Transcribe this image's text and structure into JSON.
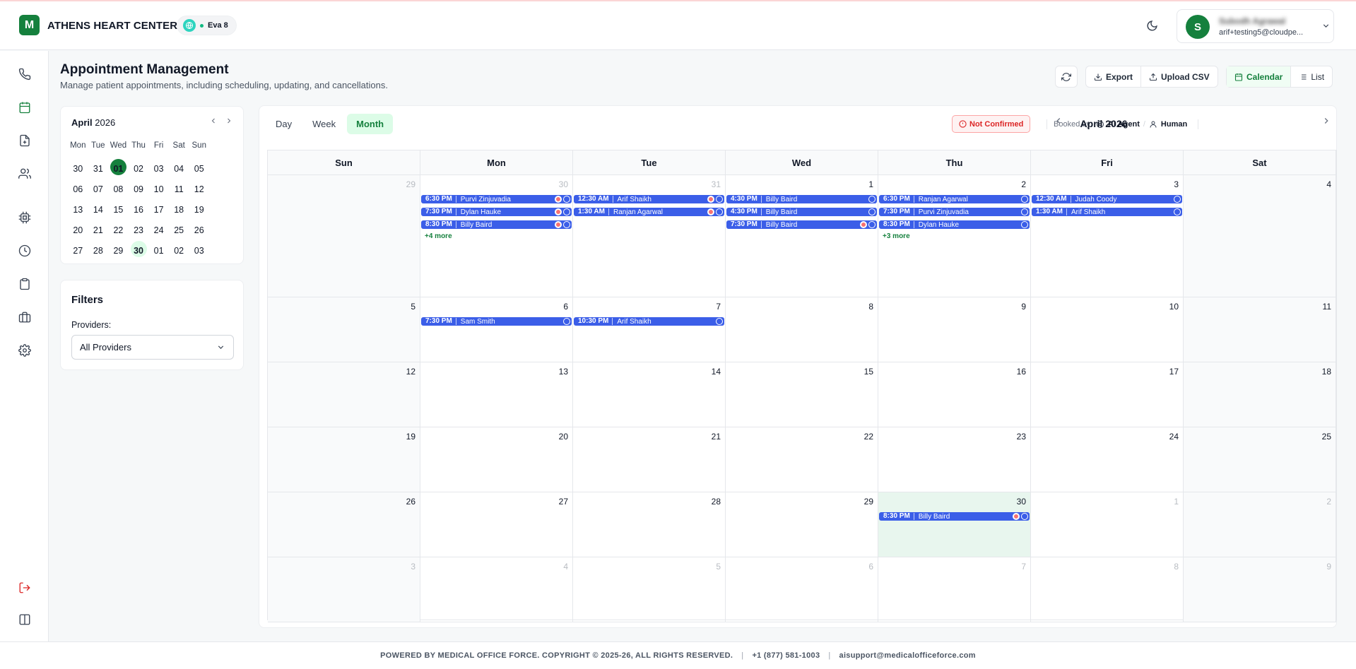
{
  "header": {
    "logo_letter": "M",
    "org_name": "ATHENS HEART CENTER",
    "agent_label": "Eva 8",
    "user_initial": "S",
    "user_name": "Subodh Agrawal",
    "user_email": "arif+testing5@cloudpe..."
  },
  "page": {
    "title": "Appointment Management",
    "subtitle": "Manage patient appointments, including scheduling, updating, and cancellations."
  },
  "toolbar": {
    "export_label": "Export",
    "upload_label": "Upload CSV",
    "calendar_label": "Calendar",
    "list_label": "List"
  },
  "mini_calendar": {
    "month": "April",
    "year": "2026",
    "weekdays": [
      "Mon",
      "Tue",
      "Wed",
      "Thu",
      "Fri",
      "Sat",
      "Sun"
    ],
    "weeks": [
      [
        "30",
        "31",
        "01",
        "02",
        "03",
        "04",
        "05"
      ],
      [
        "06",
        "07",
        "08",
        "09",
        "10",
        "11",
        "12"
      ],
      [
        "13",
        "14",
        "15",
        "16",
        "17",
        "18",
        "19"
      ],
      [
        "20",
        "21",
        "22",
        "23",
        "24",
        "25",
        "26"
      ],
      [
        "27",
        "28",
        "29",
        "30",
        "01",
        "02",
        "03"
      ]
    ],
    "selected": "01",
    "today": "30"
  },
  "filters": {
    "title": "Filters",
    "providers_label": "Providers:",
    "providers_value": "All Providers"
  },
  "calendar": {
    "views": [
      "Day",
      "Week",
      "Month"
    ],
    "active_view": "Month",
    "not_confirmed_label": "Not Confirmed",
    "booked_by_label": "Booked by:",
    "ai_agent_label": "AI Agent",
    "human_label": "Human",
    "month_title": "April 2026",
    "day_headers": [
      "Sun",
      "Mon",
      "Tue",
      "Wed",
      "Thu",
      "Fri",
      "Sat"
    ],
    "weeks": [
      [
        "29",
        "30",
        "31",
        "1",
        "2",
        "3",
        "4"
      ],
      [
        "5",
        "6",
        "7",
        "8",
        "9",
        "10",
        "11"
      ],
      [
        "12",
        "13",
        "14",
        "15",
        "16",
        "17",
        "18"
      ],
      [
        "19",
        "20",
        "21",
        "22",
        "23",
        "24",
        "25"
      ],
      [
        "26",
        "27",
        "28",
        "29",
        "30",
        "1",
        "2"
      ],
      [
        "3",
        "4",
        "5",
        "6",
        "7",
        "8",
        "9"
      ]
    ],
    "events": [
      {
        "week": 0,
        "day": 1,
        "slot": 0,
        "time": "6:30 PM",
        "name": "Purvi Zinjuvadia",
        "priority": true
      },
      {
        "week": 0,
        "day": 1,
        "slot": 1,
        "time": "7:30 PM",
        "name": "Dylan Hauke",
        "priority": true
      },
      {
        "week": 0,
        "day": 1,
        "slot": 2,
        "time": "8:30 PM",
        "name": "Billy Baird",
        "priority": true
      },
      {
        "week": 0,
        "day": 2,
        "slot": 0,
        "time": "12:30 AM",
        "name": "Arif Shaikh",
        "priority": true
      },
      {
        "week": 0,
        "day": 2,
        "slot": 1,
        "time": "1:30 AM",
        "name": "Ranjan Agarwal",
        "priority": true
      },
      {
        "week": 0,
        "day": 3,
        "slot": 0,
        "time": "4:30 PM",
        "name": "Billy Baird",
        "priority": false
      },
      {
        "week": 0,
        "day": 3,
        "slot": 1,
        "time": "4:30 PM",
        "name": "Billy Baird",
        "priority": false
      },
      {
        "week": 0,
        "day": 3,
        "slot": 2,
        "time": "7:30 PM",
        "name": "Billy Baird",
        "priority": true
      },
      {
        "week": 0,
        "day": 4,
        "slot": 0,
        "time": "6:30 PM",
        "name": "Ranjan Agarwal",
        "priority": false
      },
      {
        "week": 0,
        "day": 4,
        "slot": 1,
        "time": "7:30 PM",
        "name": "Purvi Zinjuvadia",
        "priority": false
      },
      {
        "week": 0,
        "day": 4,
        "slot": 2,
        "time": "8:30 PM",
        "name": "Dylan Hauke",
        "priority": false
      },
      {
        "week": 0,
        "day": 5,
        "slot": 0,
        "time": "12:30 AM",
        "name": "Judah Coody",
        "priority": false
      },
      {
        "week": 0,
        "day": 5,
        "slot": 1,
        "time": "1:30 AM",
        "name": "Arif Shaikh",
        "priority": false
      },
      {
        "week": 1,
        "day": 1,
        "slot": 0,
        "time": "7:30 PM",
        "name": "Sam Smith",
        "priority": false
      },
      {
        "week": 1,
        "day": 2,
        "slot": 0,
        "time": "10:30 PM",
        "name": "Arif Shaikh",
        "priority": false
      },
      {
        "week": 4,
        "day": 4,
        "slot": 0,
        "time": "8:30 PM",
        "name": "Billy Baird",
        "priority": true
      }
    ],
    "more": [
      {
        "week": 0,
        "day": 1,
        "label": "+4 more"
      },
      {
        "week": 0,
        "day": 4,
        "label": "+3 more"
      }
    ]
  },
  "footer": {
    "copyright": "POWERED BY MEDICAL OFFICE FORCE. COPYRIGHT © 2025-26, ALL RIGHTS RESERVED.",
    "phone": "+1 (877) 581-1003",
    "email": "aisupport@medicalofficeforce.com"
  },
  "colors": {
    "brand": "#15803d",
    "event": "#3b5ee8",
    "today_bg": "#e8f6ee",
    "not_confirmed": "#dc2626"
  }
}
